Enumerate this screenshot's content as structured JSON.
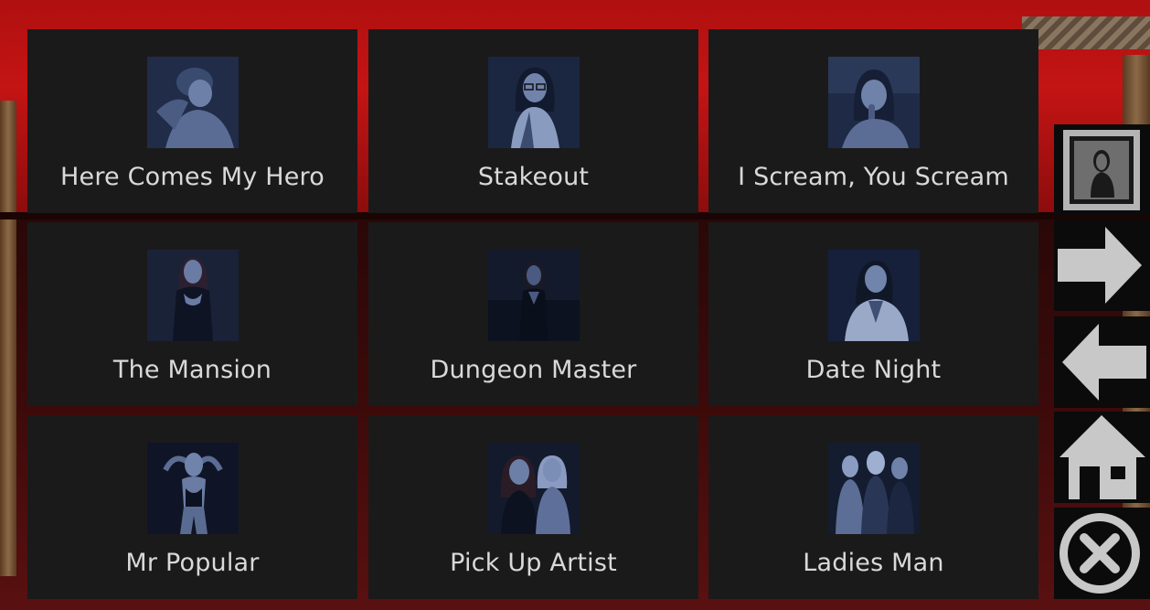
{
  "scenes": [
    {
      "title": "Here Comes My Hero",
      "thumb": "portrait-woman-lying"
    },
    {
      "title": "Stakeout",
      "thumb": "portrait-woman-glasses"
    },
    {
      "title": "I Scream, You Scream",
      "thumb": "portrait-woman-icecream"
    },
    {
      "title": "The Mansion",
      "thumb": "portrait-woman-standing"
    },
    {
      "title": "Dungeon Master",
      "thumb": "portrait-woman-dark-room"
    },
    {
      "title": "Date Night",
      "thumb": "portrait-woman-white-shirt"
    },
    {
      "title": "Mr Popular",
      "thumb": "portrait-woman-posing"
    },
    {
      "title": "Pick Up Artist",
      "thumb": "portrait-two-women"
    },
    {
      "title": "Ladies Man",
      "thumb": "portrait-three-women"
    }
  ],
  "side_buttons": [
    {
      "name": "gallery",
      "icon": "framed-portrait-icon"
    },
    {
      "name": "next",
      "icon": "arrow-right-icon"
    },
    {
      "name": "previous",
      "icon": "arrow-left-icon"
    },
    {
      "name": "home",
      "icon": "house-icon"
    },
    {
      "name": "close",
      "icon": "close-circle-icon"
    }
  ],
  "colors": {
    "tile_bg": "#1b1a1b",
    "label": "#d9d9d9",
    "icon": "#c8c8c8",
    "thumb_tint": "#1e2a44"
  }
}
